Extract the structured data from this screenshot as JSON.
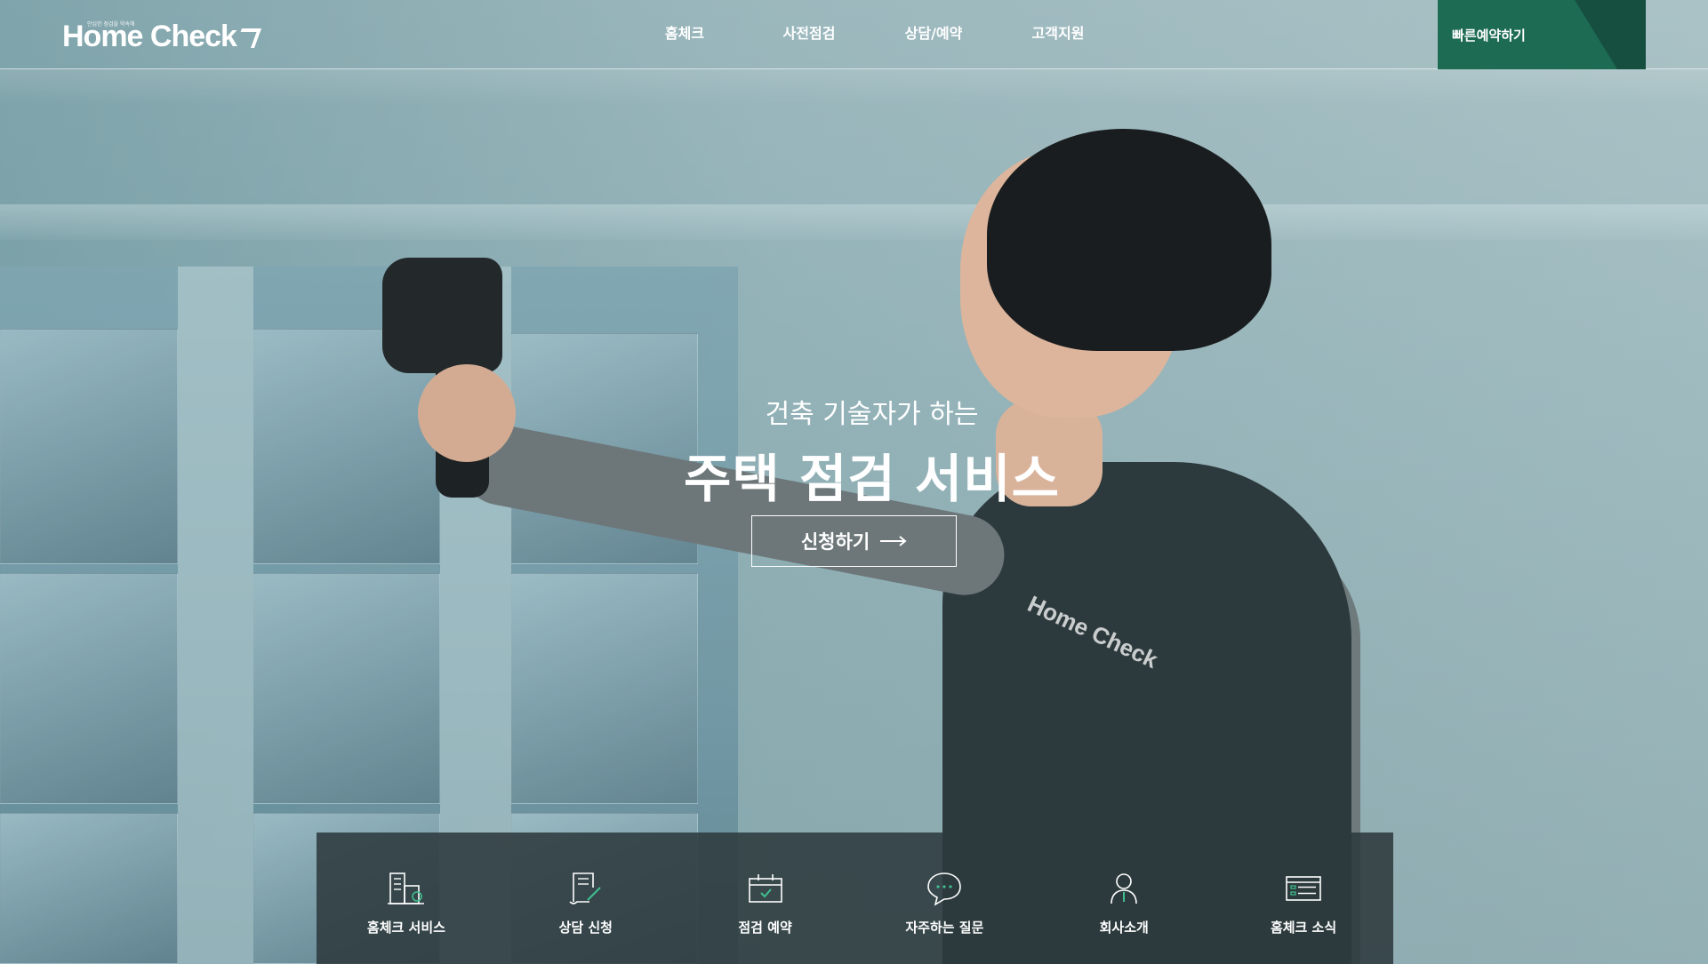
{
  "header": {
    "logo_text": "Home Check",
    "logo_tagline": "안심한 점검을 약속해",
    "nav": [
      {
        "label": "홈체크"
      },
      {
        "label": "사전점검"
      },
      {
        "label": "상담/예약"
      },
      {
        "label": "고객지원"
      }
    ],
    "quick_reservation_label": "빠른예약하기"
  },
  "hero": {
    "subtitle": "건축 기술자가 하는",
    "title": "주택 점검 서비스",
    "cta_label": "신청하기",
    "vest_logo_text": "Home Check"
  },
  "quick_menu": [
    {
      "label": "홈체크 서비스",
      "icon": "building-icon"
    },
    {
      "label": "상담 신청",
      "icon": "document-pen-icon"
    },
    {
      "label": "점검 예약",
      "icon": "calendar-check-icon"
    },
    {
      "label": "자주하는 질문",
      "icon": "speech-bubble-icon"
    },
    {
      "label": "회사소개",
      "icon": "person-icon"
    },
    {
      "label": "홈체크 소식",
      "icon": "news-list-icon"
    }
  ],
  "colors": {
    "accent_green": "#1d6b52",
    "accent_green_dark": "#164f3f",
    "check_green": "#3fbf8f",
    "menu_bg": "#2d3a3e"
  }
}
